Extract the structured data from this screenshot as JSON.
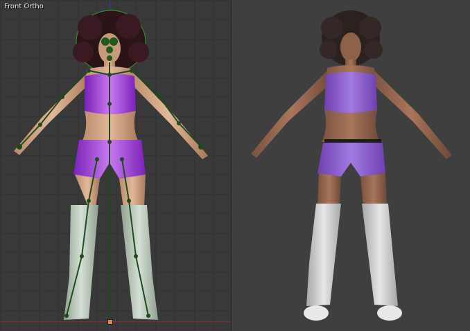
{
  "left_viewport": {
    "view_label": "Front Ortho"
  },
  "colors": {
    "background": "#3a3a3a",
    "grid": "#333333",
    "x_axis": "#8a2a2a",
    "z_axis": "#3a3a9a",
    "armature": "#1f4a1f",
    "outfit": "#9a4ad6",
    "stockings": "#d8dcd8"
  }
}
